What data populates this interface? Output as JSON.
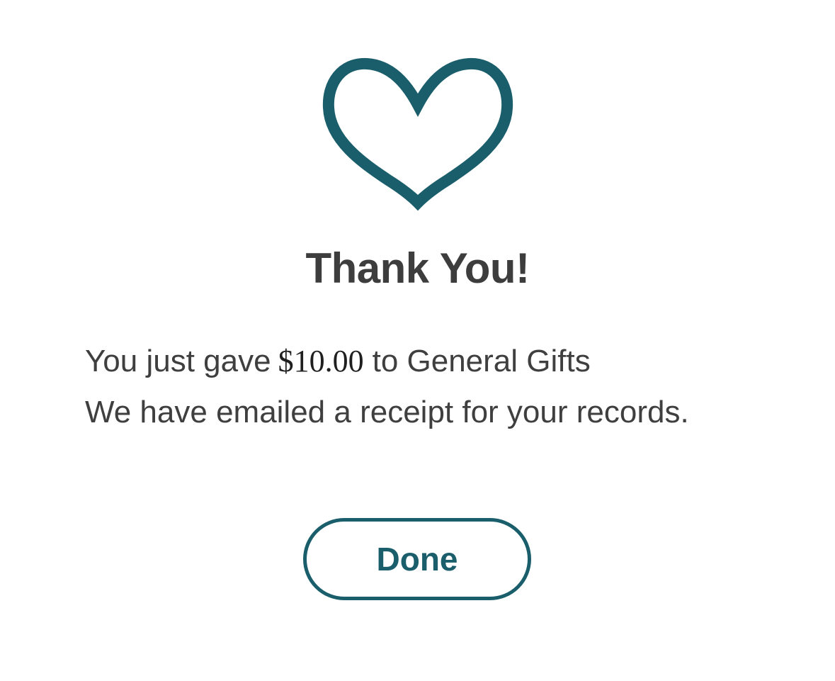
{
  "icon": {
    "name": "heart-icon",
    "color": "#1a5e6b"
  },
  "title": "Thank You!",
  "message": {
    "prefix": "You just gave",
    "amount": "$10.00",
    "suffix": "to General Gifts",
    "line2": "We have emailed a receipt for your records."
  },
  "done_button": {
    "label": "Done",
    "color": "#1a5e6b"
  }
}
